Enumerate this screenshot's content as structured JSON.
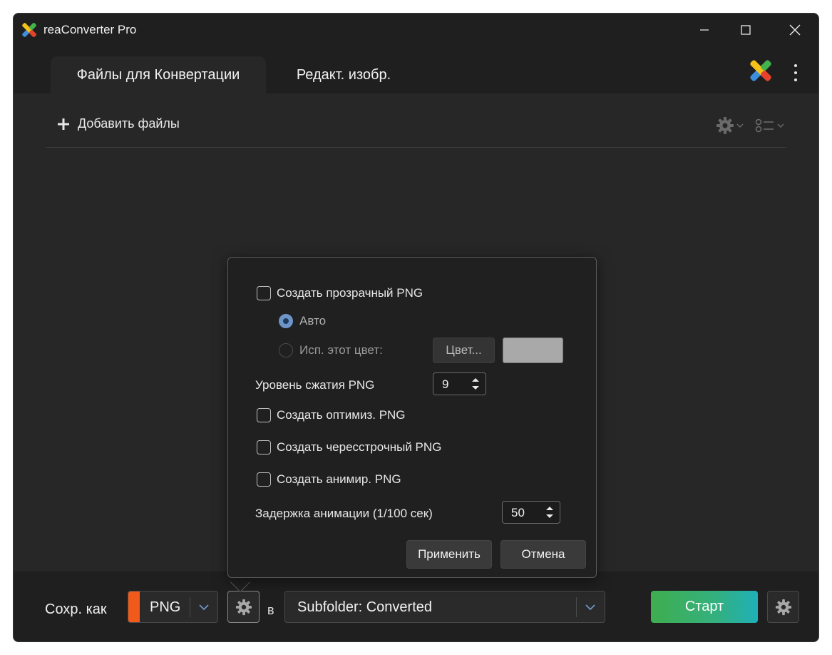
{
  "window": {
    "title": "reaConverter Pro"
  },
  "tabs": [
    {
      "label": "Файлы для Конвертации",
      "active": true
    },
    {
      "label": "Редакт. изобр.",
      "active": false
    }
  ],
  "toolbar": {
    "add_files_label": "Добавить файлы",
    "settings_icon": "gear-icon",
    "view_icon": "list-view-icon"
  },
  "popup": {
    "transparent_png_label": "Создать прозрачный PNG",
    "transparent_png_checked": false,
    "auto_label": "Авто",
    "use_color_label": "Исп. этот цвет:",
    "color_button_label": "Цвет...",
    "swatch_color": "#a9a9a9",
    "compression_label": "Уровень сжатия PNG",
    "compression_value": "9",
    "optimized_label": "Создать оптимиз. PNG",
    "interlaced_label": "Создать чересстрочный PNG",
    "animated_label": "Создать анимир. PNG",
    "delay_label": "Задержка анимации (1/100 сек)",
    "delay_value": "50",
    "apply_label": "Применить",
    "cancel_label": "Отмена"
  },
  "bottom": {
    "save_as_label": "Сохр. как",
    "format_value": "PNG",
    "format_color": "#f05a1a",
    "in_label": "в",
    "folder_value": "Subfolder: Converted",
    "start_label": "Старт"
  },
  "colors": {
    "accent_blue": "#6e95c8",
    "start_green": "#3fae4f",
    "start_teal": "#1fb0b8"
  }
}
